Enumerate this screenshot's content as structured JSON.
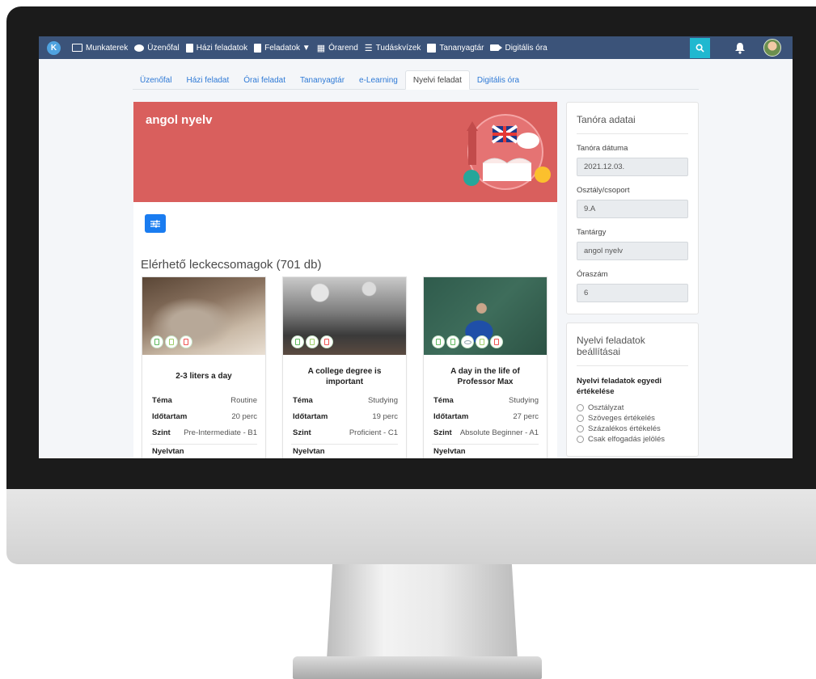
{
  "nav": {
    "logo": "K",
    "items": [
      {
        "label": "Munkaterek",
        "icon": "laptop-icon"
      },
      {
        "label": "Üzenőfal",
        "icon": "chat-bubble-icon"
      },
      {
        "label": "Házi feladatok",
        "icon": "document-icon"
      },
      {
        "label": "Feladatok ▼",
        "icon": "clipboard-icon"
      },
      {
        "label": "Órarend",
        "icon": "calendar-icon"
      },
      {
        "label": "Tudáskvízek",
        "icon": "list-icon"
      },
      {
        "label": "Tananyagtár",
        "icon": "book-icon"
      },
      {
        "label": "Digitális óra",
        "icon": "video-camera-icon"
      }
    ]
  },
  "tabs": [
    {
      "label": "Üzenőfal",
      "active": false
    },
    {
      "label": "Házi feladat",
      "active": false
    },
    {
      "label": "Órai feladat",
      "active": false
    },
    {
      "label": "Tananyagtár",
      "active": false
    },
    {
      "label": "e-Learning",
      "active": false
    },
    {
      "label": "Nyelvi feladat",
      "active": true
    },
    {
      "label": "Digitális óra",
      "active": false
    }
  ],
  "banner": {
    "title": "angol nyelv",
    "color": "#d95f5d"
  },
  "section_title": "Elérhető leckecsomagok (701 db)",
  "cards": [
    {
      "title": "2-3 liters a day",
      "labels": {
        "topic": "Téma",
        "duration": "Időtartam",
        "level": "Szint",
        "grammar": "Nyelvtan"
      },
      "topic": "Routine",
      "duration": "20 perc",
      "level": "Pre-Intermediate - B1",
      "badges": [
        "doc",
        "play",
        "red"
      ]
    },
    {
      "title": "A college degree is important",
      "labels": {
        "topic": "Téma",
        "duration": "Időtartam",
        "level": "Szint",
        "grammar": "Nyelvtan"
      },
      "topic": "Studying",
      "duration": "19 perc",
      "level": "Proficient - C1",
      "badges": [
        "doc",
        "play",
        "red"
      ]
    },
    {
      "title": "A day in the life of Professor Max",
      "labels": {
        "topic": "Téma",
        "duration": "Időtartam",
        "level": "Szint",
        "grammar": "Nyelvtan"
      },
      "topic": "Studying",
      "duration": "27 perc",
      "level": "Absolute Beginner - A1",
      "badges": [
        "doc",
        "doc",
        "eye",
        "play",
        "red"
      ]
    }
  ],
  "lesson_panel": {
    "title": "Tanóra adatai",
    "date_label": "Tanóra dátuma",
    "date_value": "2021.12.03.",
    "class_label": "Osztály/csoport",
    "class_value": "9.A",
    "subject_label": "Tantárgy",
    "subject_value": "angol nyelv",
    "hours_label": "Óraszám",
    "hours_value": "6"
  },
  "settings_panel": {
    "title": "Nyelvi feladatok beállításai",
    "subtitle": "Nyelvi feladatok egyedi értékelése",
    "options": [
      "Osztályzat",
      "Szöveges értékelés",
      "Százalékos értékelés",
      "Csak elfogadás jelölés"
    ]
  },
  "colors": {
    "nav": "#3b5379",
    "accent": "#1a7cf0",
    "banner": "#d95f5d",
    "search": "#20b8d0"
  }
}
